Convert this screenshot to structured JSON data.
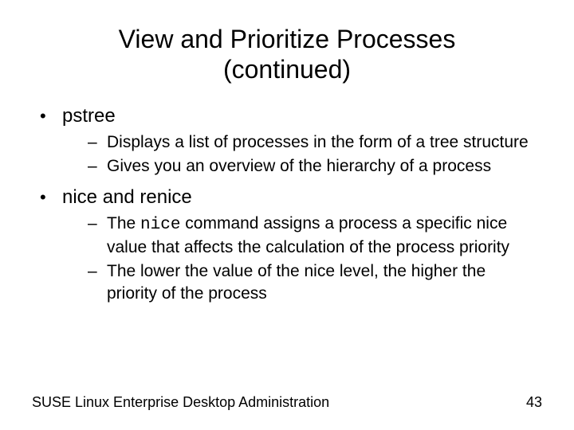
{
  "slide": {
    "title_line1": "View and Prioritize Processes",
    "title_line2": "(continued)",
    "items": [
      {
        "label": "pstree",
        "sub": [
          {
            "text": "Displays a list of processes in the form of a tree structure"
          },
          {
            "text": "Gives you an overview of the hierarchy of a process"
          }
        ]
      },
      {
        "label": "nice and renice",
        "sub": [
          {
            "prefix": "The ",
            "code": "nice",
            "suffix": " command assigns a process a specific nice value that affects the calculation of the process priority"
          },
          {
            "text": "The lower the value of the nice level, the higher the priority of the process"
          }
        ]
      }
    ]
  },
  "footer": {
    "left": "SUSE Linux Enterprise Desktop Administration",
    "page": "43"
  }
}
